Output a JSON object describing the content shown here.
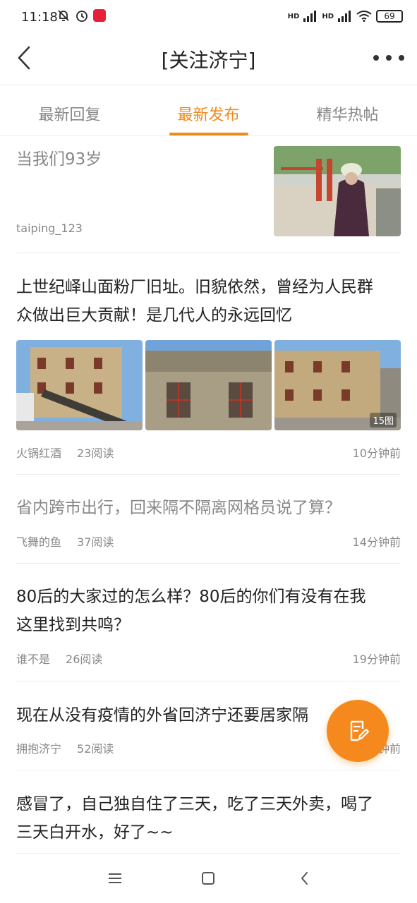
{
  "status_bar": {
    "time": "11:18",
    "battery": "69",
    "signal_1": "HD",
    "signal_2": "HD"
  },
  "header": {
    "title": "[关注济宁]"
  },
  "tabs": [
    {
      "label": "最新回复",
      "active": false
    },
    {
      "label": "最新发布",
      "active": true
    },
    {
      "label": "精华热帖",
      "active": false
    }
  ],
  "posts": [
    {
      "title": "当我们93岁",
      "author": "taiping_123"
    },
    {
      "title_line1": "上世纪峄山面粉厂旧址。旧貌依然，曾经为人民群",
      "title_line2": "众做出巨大贡献！是几代人的永远回忆",
      "author": "火锅红酒",
      "reads": "23阅读",
      "time": "10分钟前",
      "image_count": "15图"
    },
    {
      "title": "省内跨市出行，回来隔不隔离网格员说了算？",
      "author": "飞舞的鱼",
      "reads": "37阅读",
      "time": "14分钟前"
    },
    {
      "title_line1": "80后的大家过的怎么样？80后的你们有没有在我",
      "title_line2": "这里找到共鸣？",
      "author": "谁不是",
      "reads": "26阅读",
      "time": "19分钟前"
    },
    {
      "title": "现在从没有疫情的外省回济宁还要居家隔",
      "author": "拥抱济宁",
      "reads": "52阅读",
      "time": "分钟前"
    },
    {
      "title_line1": "感冒了，自己独自住了三天，吃了三天外卖，喝了",
      "title_line2": "三天白开水，好了~~"
    }
  ],
  "colors": {
    "accent": "#f08a1a",
    "text": "#222222",
    "muted": "#888888"
  }
}
